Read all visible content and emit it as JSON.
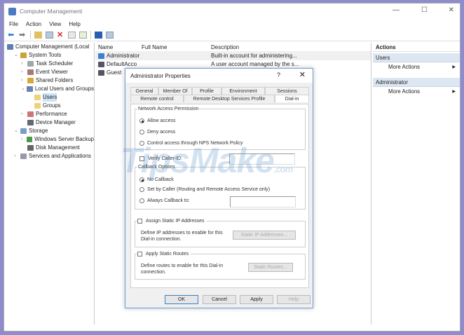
{
  "window": {
    "title": "Computer Management",
    "controls": [
      "—",
      "☐",
      "✕"
    ]
  },
  "menu": [
    "File",
    "Action",
    "View",
    "Help"
  ],
  "tree": [
    {
      "label": "Computer Management (Local",
      "indent": 0,
      "arrow": "",
      "color": "#5b7fb3"
    },
    {
      "label": "System Tools",
      "indent": 1,
      "arrow": "⌄",
      "color": "#c9a23c"
    },
    {
      "label": "Task Scheduler",
      "indent": 2,
      "arrow": "›",
      "color": "#9aa"
    },
    {
      "label": "Event Viewer",
      "indent": 2,
      "arrow": "›",
      "color": "#a77"
    },
    {
      "label": "Shared Folders",
      "indent": 2,
      "arrow": "›",
      "color": "#d4a83a"
    },
    {
      "label": "Local Users and Groups",
      "indent": 2,
      "arrow": "⌄",
      "color": "#6a84b0"
    },
    {
      "label": "Users",
      "indent": 3,
      "arrow": "",
      "color": "#f1d07a",
      "selected": true
    },
    {
      "label": "Groups",
      "indent": 3,
      "arrow": "",
      "color": "#f1d07a"
    },
    {
      "label": "Performance",
      "indent": 2,
      "arrow": "›",
      "color": "#c77"
    },
    {
      "label": "Device Manager",
      "indent": 2,
      "arrow": "",
      "color": "#667"
    },
    {
      "label": "Storage",
      "indent": 1,
      "arrow": "⌄",
      "color": "#7a9cc6"
    },
    {
      "label": "Windows Server Backup",
      "indent": 2,
      "arrow": "›",
      "color": "#4a9a4a"
    },
    {
      "label": "Disk Management",
      "indent": 2,
      "arrow": "",
      "color": "#666"
    },
    {
      "label": "Services and Applications",
      "indent": 1,
      "arrow": "›",
      "color": "#99a"
    }
  ],
  "list": {
    "headers": [
      "Name",
      "Full Name",
      "Description"
    ],
    "rows": [
      [
        "Administrator",
        "",
        "Built-in account for administering..."
      ],
      [
        "DefaultAcco",
        "",
        "A user account managed by the s..."
      ],
      [
        "Guest",
        "",
        ""
      ]
    ]
  },
  "actions": {
    "header": "Actions",
    "sections": [
      {
        "title": "Users",
        "item": "More Actions"
      },
      {
        "title": "Administrator",
        "item": "More Actions"
      }
    ]
  },
  "dialog": {
    "title": "Administrator Properties",
    "help": "?",
    "close": "✕",
    "tabs_row1": [
      "General",
      "Member Of",
      "Profile",
      "Environment",
      "Sessions"
    ],
    "tabs_row2": [
      "Remote control",
      "Remote Desktop Services Profile",
      "Dial-in"
    ],
    "nap": {
      "legend": "Network Access Permission",
      "options": [
        "Allow access",
        "Deny access",
        "Control access through NPS Network Policy"
      ],
      "selected": 0
    },
    "verify": "Verify Caller-ID:",
    "callback": {
      "legend": "Callback Options",
      "options": [
        "No Callback",
        "Set by Caller (Routing and Remote Access Service only)",
        "Always Callback to:"
      ],
      "selected": 0
    },
    "static_ip": {
      "label": "Assign Static IP Addresses",
      "desc": "Define IP addresses to enable for this Dial-in connection.",
      "button": "Static IP Addresses..."
    },
    "routes": {
      "label": "Apply Static Routes",
      "desc": "Define routes to enable for this Dial-in connection.",
      "button": "Static Routes..."
    },
    "buttons": [
      "OK",
      "Cancel",
      "Apply",
      "Help"
    ]
  },
  "watermark": {
    "main": "TipsMake",
    "suffix": ".com"
  }
}
